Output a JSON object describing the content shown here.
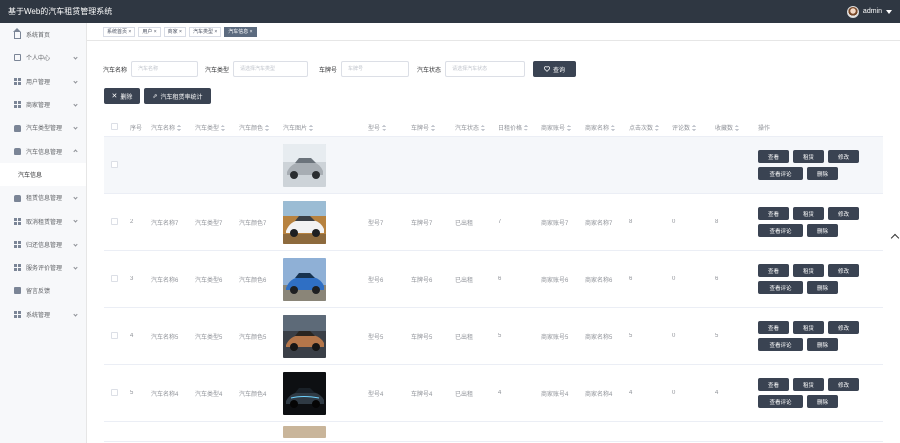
{
  "app": {
    "title": "基于Web的汽车租赁管理系统",
    "user": "admin"
  },
  "sidebar": {
    "items": [
      {
        "label": "系统首页",
        "icon": "home-icon"
      },
      {
        "label": "个人中心",
        "icon": "doc-icon"
      },
      {
        "label": "用户管理",
        "icon": "grid-icon"
      },
      {
        "label": "商家管理",
        "icon": "grid-icon"
      },
      {
        "label": "汽车类型管理",
        "icon": "car-icon"
      },
      {
        "label": "汽车信息管理",
        "icon": "car-icon"
      },
      {
        "label": "汽车信息",
        "icon": ""
      },
      {
        "label": "租赁信息管理",
        "icon": "car-icon"
      },
      {
        "label": "取消租赁管理",
        "icon": "grid-icon"
      },
      {
        "label": "归还信息管理",
        "icon": "grid-icon"
      },
      {
        "label": "服务评价管理",
        "icon": "grid-icon"
      },
      {
        "label": "留言反馈",
        "icon": "bag-icon"
      },
      {
        "label": "系统管理",
        "icon": "grid-icon"
      }
    ]
  },
  "tags": [
    "系统首页 ×",
    "用户 ×",
    "商家 ×",
    "汽车类型 ×",
    "汽车信息 ×"
  ],
  "filters": {
    "name_label": "汽车名称",
    "name_placeholder": "汽车名称",
    "type_label": "汽车类型",
    "type_placeholder": "请选择汽车类型",
    "plate_label": "车牌号",
    "plate_placeholder": "车牌号",
    "status_label": "汽车状态",
    "status_placeholder": "请选择汽车状态",
    "search_label": "查询"
  },
  "actions": {
    "delete_label": "删除",
    "stats_label": "汽车租赁率统计"
  },
  "table": {
    "headers": [
      "序号",
      "汽车名称",
      "汽车类型",
      "汽车颜色",
      "汽车图片",
      "型号",
      "车牌号",
      "汽车状态",
      "日租价格",
      "商家账号",
      "商家名称",
      "点击次数",
      "评论数",
      "收藏数",
      "操作"
    ],
    "rows": [
      {
        "idx": "",
        "name": "",
        "type": "",
        "color": "",
        "model": "",
        "plate": "",
        "status": "",
        "rent": "",
        "mno": "",
        "mname": "",
        "click": "",
        "rate": "",
        "fav": "",
        "img": "silver-car"
      },
      {
        "idx": "2",
        "name": "汽车名称7",
        "type": "汽车类型7",
        "color": "汽车颜色7",
        "model": "型号7",
        "plate": "车牌号7",
        "status": "已出租",
        "rent": "7",
        "mno": "商家账号7",
        "mname": "商家名称7",
        "click": "8",
        "rate": "0",
        "fav": "8",
        "img": "white-car"
      },
      {
        "idx": "3",
        "name": "汽车名称6",
        "type": "汽车类型6",
        "color": "汽车颜色6",
        "model": "型号6",
        "plate": "车牌号6",
        "status": "已出租",
        "rent": "6",
        "mno": "商家账号6",
        "mname": "商家名称6",
        "click": "6",
        "rate": "0",
        "fav": "6",
        "img": "blue-car"
      },
      {
        "idx": "4",
        "name": "汽车名称5",
        "type": "汽车类型5",
        "color": "汽车颜色5",
        "model": "型号5",
        "plate": "车牌号5",
        "status": "已出租",
        "rent": "5",
        "mno": "商家账号5",
        "mname": "商家名称5",
        "click": "5",
        "rate": "0",
        "fav": "5",
        "img": "orange-car"
      },
      {
        "idx": "5",
        "name": "汽车名称4",
        "type": "汽车类型4",
        "color": "汽车颜色4",
        "model": "型号4",
        "plate": "车牌号4",
        "status": "已出租",
        "rent": "4",
        "mno": "商家账号4",
        "mname": "商家名称4",
        "click": "4",
        "rate": "0",
        "fav": "4",
        "img": "dark-car"
      }
    ],
    "op_labels": {
      "view": "查看",
      "rent": "租赁",
      "edit": "修改",
      "reviews": "查看评论",
      "delete": "删除"
    }
  },
  "colors": {
    "header_bg": "#2f3742",
    "button_bg": "#3a4352",
    "sidebar_bg": "#f7f8fa"
  }
}
